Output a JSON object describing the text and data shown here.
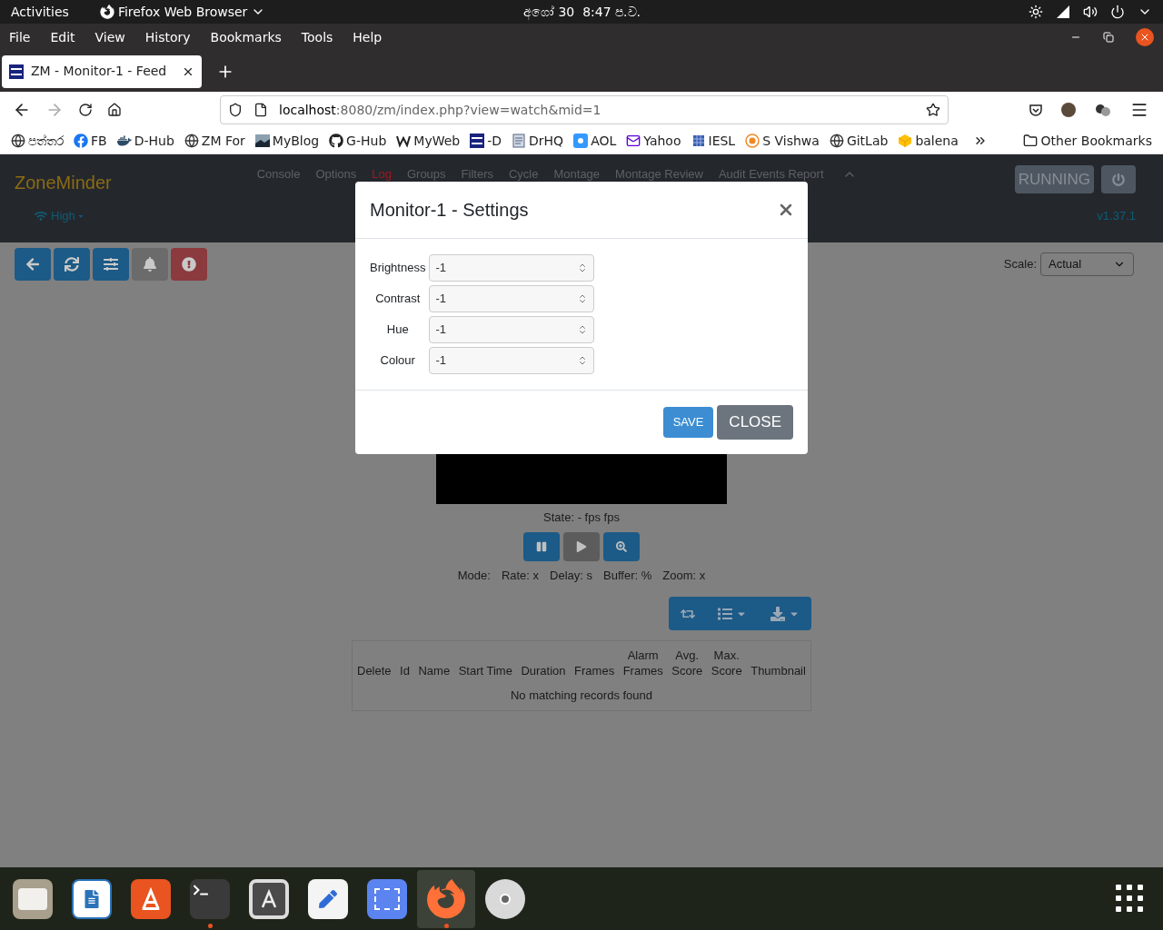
{
  "topbar": {
    "activities": "Activities",
    "app": "Firefox Web Browser",
    "date": "අගෝ 30",
    "time": "8:47 ප.ව."
  },
  "menu": [
    "File",
    "Edit",
    "View",
    "History",
    "Bookmarks",
    "Tools",
    "Help"
  ],
  "tab": {
    "title": "ZM - Monitor-1 - Feed"
  },
  "url": {
    "host": "localhost",
    "rest": ":8080/zm/index.php?view=watch&mid=1"
  },
  "bookmarks": [
    {
      "label": "පත්තර",
      "kind": "globe"
    },
    {
      "label": "FB",
      "kind": "facebook"
    },
    {
      "label": "D-Hub",
      "kind": "docker"
    },
    {
      "label": "ZM For",
      "kind": "globe"
    },
    {
      "label": "MyBlog",
      "kind": "photo"
    },
    {
      "label": "G-Hub",
      "kind": "github"
    },
    {
      "label": "MyWeb",
      "kind": "w"
    },
    {
      "label": "-D",
      "kind": "zm"
    },
    {
      "label": "DrHQ",
      "kind": "doc"
    },
    {
      "label": "AOL",
      "kind": "aol"
    },
    {
      "label": "Yahoo",
      "kind": "mail"
    },
    {
      "label": "IESL",
      "kind": "grid"
    },
    {
      "label": "S Vishwa",
      "kind": "ring"
    },
    {
      "label": "GitLab",
      "kind": "globe"
    },
    {
      "label": "balena",
      "kind": "cube"
    }
  ],
  "other_bookmarks": "Other Bookmarks",
  "zm": {
    "brand": "ZoneMinder",
    "nav": [
      {
        "label": "Console",
        "alert": false
      },
      {
        "label": "Options",
        "alert": false
      },
      {
        "label": "Log",
        "alert": true
      },
      {
        "label": "Groups",
        "alert": false
      },
      {
        "label": "Filters",
        "alert": false
      },
      {
        "label": "Cycle",
        "alert": false
      },
      {
        "label": "Montage",
        "alert": false
      },
      {
        "label": "Montage Review",
        "alert": false
      },
      {
        "label": "Audit Events Report",
        "alert": false
      }
    ],
    "bandwidth": "High",
    "status": "RUNNING",
    "version": "v1.37.1"
  },
  "toolbar": [
    {
      "kind": "back",
      "disabled": false
    },
    {
      "kind": "refresh",
      "disabled": false
    },
    {
      "kind": "settings",
      "disabled": false
    },
    {
      "kind": "alarm",
      "disabled": true
    },
    {
      "kind": "force",
      "disabled": false
    }
  ],
  "scale": {
    "label": "Scale:",
    "value": "Actual"
  },
  "modal": {
    "title": "Monitor-1 - Settings",
    "fields": [
      {
        "label": "Brightness",
        "value": "-1"
      },
      {
        "label": "Contrast",
        "value": "-1"
      },
      {
        "label": "Hue",
        "value": "-1"
      },
      {
        "label": "Colour",
        "value": "-1"
      }
    ],
    "save": "SAVE",
    "close": "CLOSE"
  },
  "state": "State: - fps fps",
  "controls": [
    {
      "kind": "pause",
      "disabled": false
    },
    {
      "kind": "play",
      "disabled": true
    },
    {
      "kind": "zoom",
      "disabled": false
    }
  ],
  "stats": [
    "Mode:",
    "Rate: x",
    "Delay: s",
    "Buffer: %",
    "Zoom: x"
  ],
  "table": {
    "columns": [
      {
        "lines": [
          "Delete"
        ]
      },
      {
        "lines": [
          "Id"
        ]
      },
      {
        "lines": [
          "Name"
        ]
      },
      {
        "lines": [
          "Start Time"
        ]
      },
      {
        "lines": [
          "Duration"
        ]
      },
      {
        "lines": [
          "Frames"
        ]
      },
      {
        "lines": [
          "Alarm",
          "Frames"
        ]
      },
      {
        "lines": [
          "Avg.",
          "Score"
        ]
      },
      {
        "lines": [
          "Max.",
          "Score"
        ]
      },
      {
        "lines": [
          "Thumbnail"
        ]
      }
    ],
    "empty": "No matching records found"
  },
  "dock": [
    {
      "kind": "files",
      "running": false,
      "selected": false
    },
    {
      "kind": "writer",
      "running": false,
      "selected": false
    },
    {
      "kind": "store",
      "running": false,
      "selected": false
    },
    {
      "kind": "terminal",
      "running": true,
      "selected": false
    },
    {
      "kind": "updater",
      "running": false,
      "selected": false
    },
    {
      "kind": "editor",
      "running": false,
      "selected": false
    },
    {
      "kind": "screenshot",
      "running": false,
      "selected": false
    },
    {
      "kind": "firefox",
      "running": true,
      "selected": true
    },
    {
      "kind": "disc",
      "running": false,
      "selected": false
    }
  ]
}
